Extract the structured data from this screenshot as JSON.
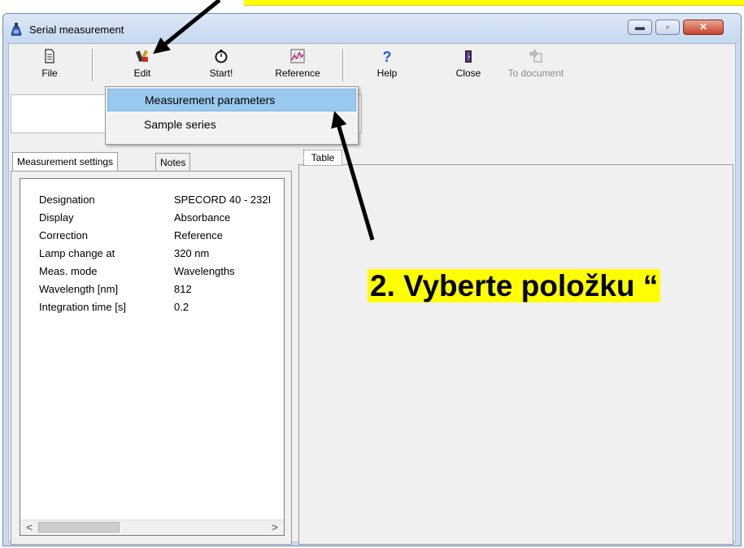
{
  "window": {
    "title": "Serial measurement"
  },
  "toolbar": {
    "file_label": "File",
    "edit_label": "Edit",
    "start_label": "Start!",
    "reference_label": "Reference",
    "help_label": "Help",
    "close_label": "Close",
    "to_document_label": "To document"
  },
  "edit_menu": {
    "items": [
      {
        "label": "Measurement parameters",
        "highlighted": true
      },
      {
        "label": "Sample series",
        "highlighted": false
      }
    ]
  },
  "left_tabs": {
    "active": "Measurement settings",
    "other": "Notes"
  },
  "settings": [
    {
      "key": "Designation",
      "value": "SPECORD 40 - 232I"
    },
    {
      "key": "Display",
      "value": "Absorbance"
    },
    {
      "key": "Correction",
      "value": "Reference"
    },
    {
      "key": "Lamp change at",
      "value": "320 nm"
    },
    {
      "key": "Meas. mode",
      "value": "Wavelengths"
    },
    {
      "key": "Wavelength [nm]",
      "value": "812"
    },
    {
      "key": "Integration time [s]",
      "value": "0.2"
    }
  ],
  "right_tab": {
    "label": "Table"
  },
  "annotation": {
    "text": "2. Vyberte položku “",
    "highlight_color": "#ffff00"
  },
  "colors": {
    "menu_highlight": "#99c9ef",
    "titlebar": "#c5d8ef",
    "close_button": "#c7442b",
    "arrow": "#000000"
  },
  "scrollbar": {
    "left_arrow": "<",
    "right_arrow": ">"
  }
}
